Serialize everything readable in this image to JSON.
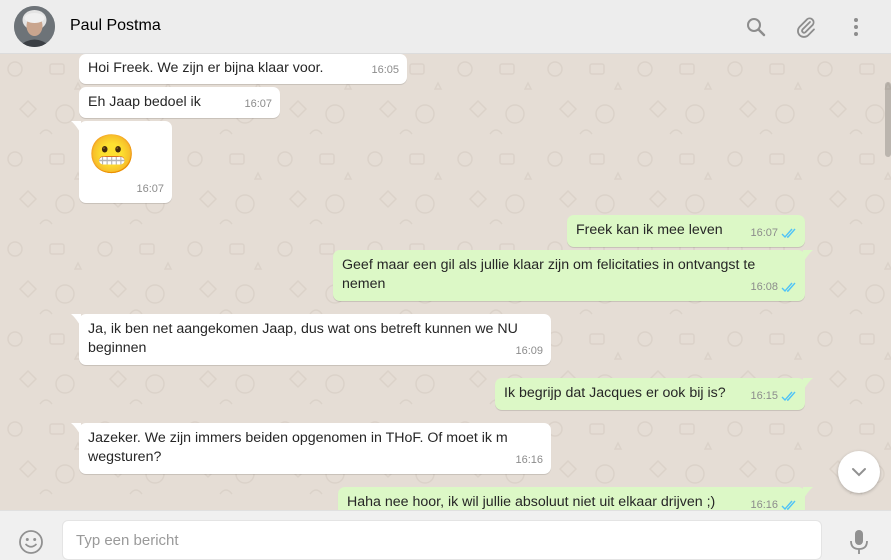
{
  "header": {
    "contact_name": "Paul Postma"
  },
  "messages": [
    {
      "dir": "in",
      "text": "Hoi Freek. We zijn er bijna klaar voor.",
      "time": "16:05"
    },
    {
      "dir": "in",
      "text": "Eh Jaap bedoel ik",
      "time": "16:07"
    },
    {
      "dir": "in",
      "text": "😬",
      "time": "16:07",
      "emoji": true
    },
    {
      "dir": "out",
      "text": "Freek kan ik mee leven",
      "time": "16:07",
      "status": "read"
    },
    {
      "dir": "out",
      "text": "Geef maar een gil als jullie klaar zijn om felicitaties in ontvangst te nemen",
      "time": "16:08",
      "status": "read"
    },
    {
      "dir": "in",
      "text": "Ja, ik ben net aangekomen Jaap, dus wat ons betreft kunnen we NU beginnen",
      "time": "16:09"
    },
    {
      "dir": "out",
      "text": "Ik begrijp dat Jacques er ook bij is?",
      "time": "16:15",
      "status": "read"
    },
    {
      "dir": "in",
      "text": "Jazeker. We zijn immers beiden opgenomen in THoF. Of moet ik m wegsturen?",
      "time": "16:16"
    },
    {
      "dir": "out",
      "text": "Haha nee hoor, ik wil jullie absoluut niet uit elkaar drijven ;)",
      "time": "16:16",
      "status": "read"
    }
  ],
  "composer": {
    "placeholder": "Typ een bericht",
    "value": ""
  },
  "icons": {
    "search": "search-icon",
    "attach": "paperclip-icon",
    "menu": "more-vertical-icon",
    "emoji": "emoji-icon",
    "mic": "microphone-icon",
    "scroll_down": "chevron-down-icon"
  },
  "colors": {
    "incoming_bubble": "#ffffff",
    "outgoing_bubble": "#dcf8c6",
    "read_ticks": "#4fc3f7",
    "chat_background": "#e5ddd5",
    "header_background": "#ededed"
  }
}
